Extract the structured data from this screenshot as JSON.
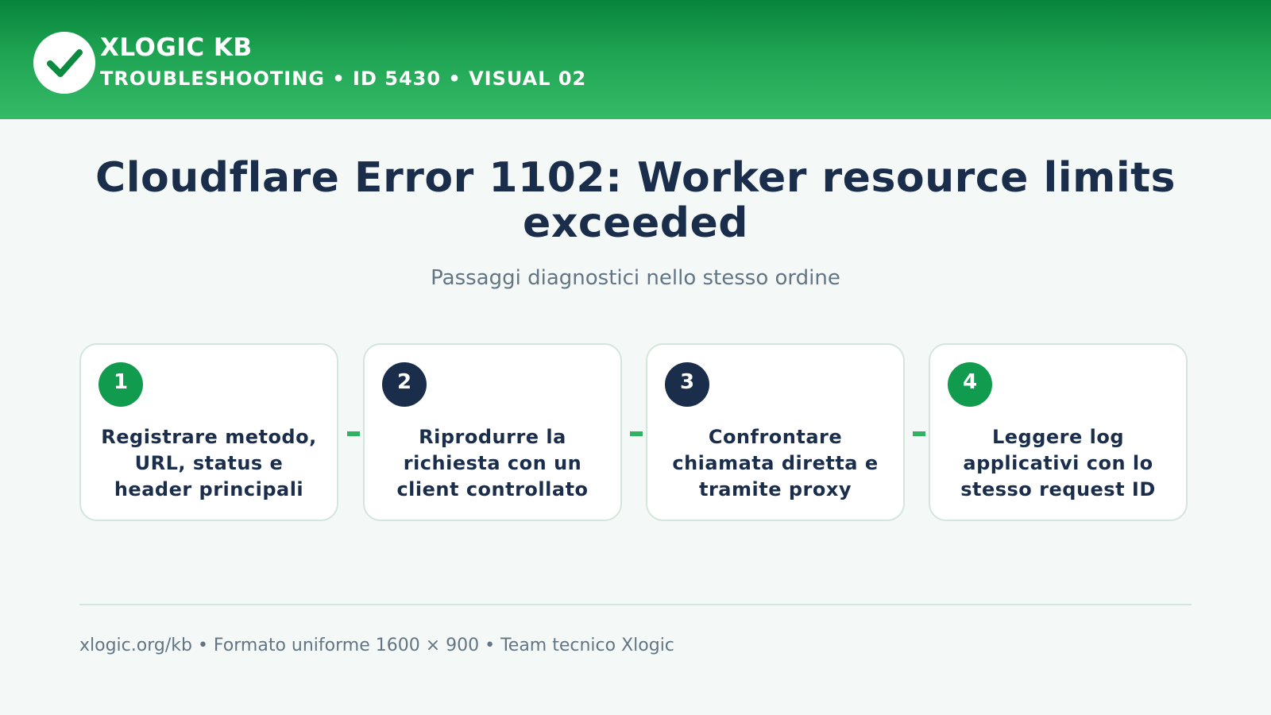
{
  "header": {
    "logo_icon": "checkmark-icon",
    "brand_name": "XLOGIC KB",
    "meta": "TROUBLESHOOTING • ID 5430 • VISUAL 02"
  },
  "main": {
    "title": "Cloudflare Error 1102: Worker resource limits exceeded",
    "subtitle": "Passaggi diagnostici nello stesso ordine",
    "steps": [
      {
        "number": "1",
        "text": "Registrare metodo, URL, status e header principali",
        "badge_color": "#109b4e"
      },
      {
        "number": "2",
        "text": "Riprodurre la richiesta con un client controllato",
        "badge_color": "#1a2e4c"
      },
      {
        "number": "3",
        "text": "Confrontare chiamata diretta e tramite proxy",
        "badge_color": "#1a2e4c"
      },
      {
        "number": "4",
        "text": "Leggere log applicativi con lo stesso request ID",
        "badge_color": "#109b4e"
      }
    ]
  },
  "footer": {
    "text": "xlogic.org/kb • Formato uniforme 1600 × 900 • Team tecnico Xlogic"
  },
  "colors": {
    "header_green": "#1ea452",
    "accent_green": "#109b4e",
    "navy": "#1a2e4c",
    "connector": "#2fb262",
    "background": "#f4f8f6"
  }
}
